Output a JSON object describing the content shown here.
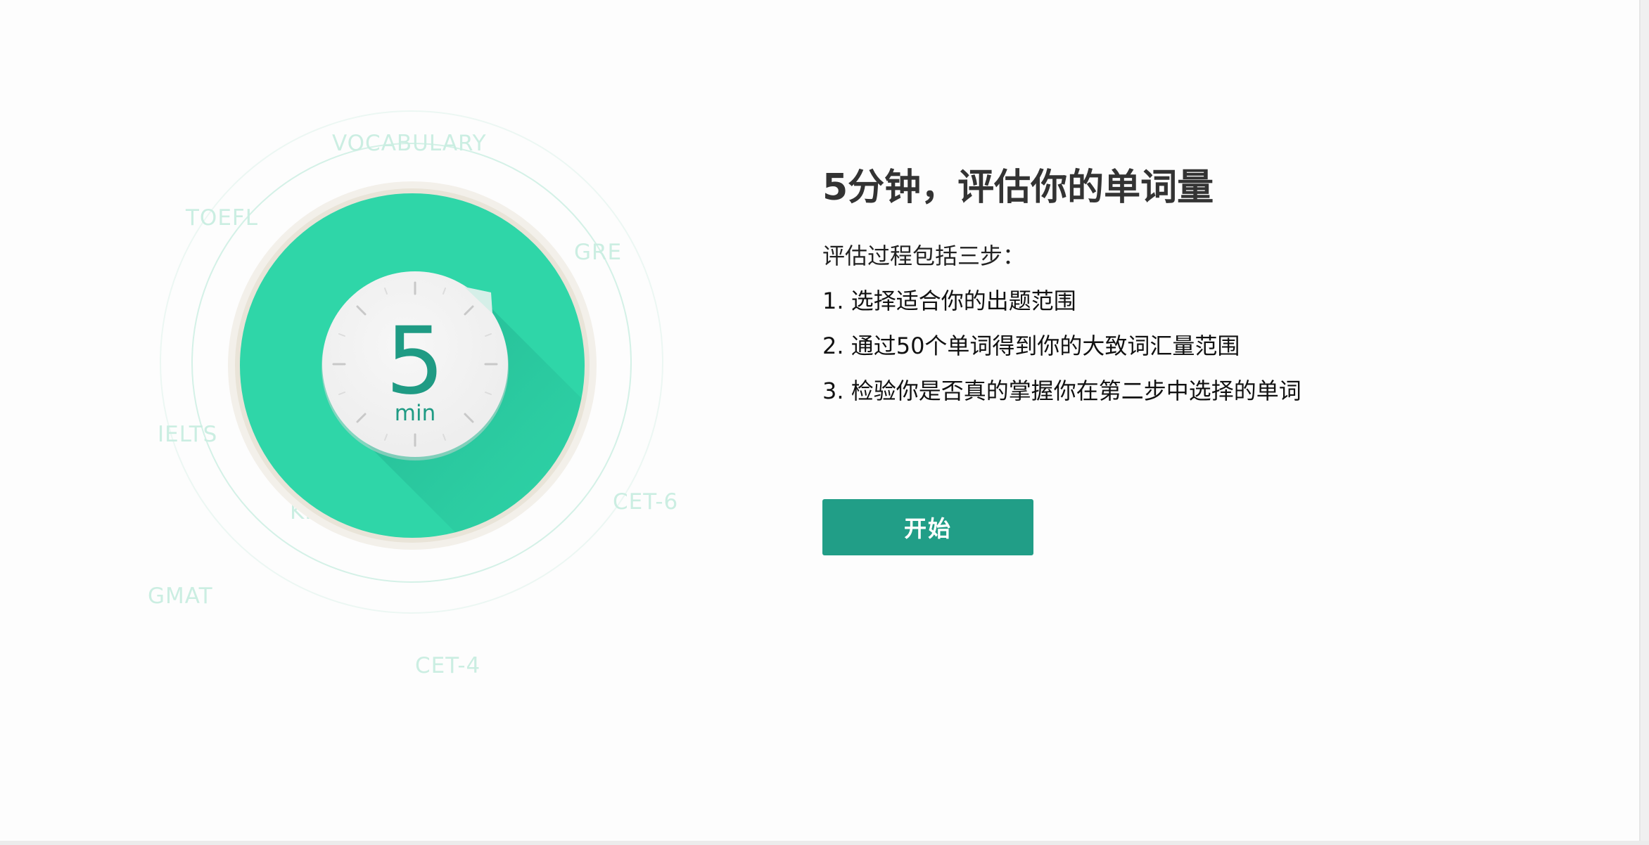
{
  "illustration": {
    "tags": {
      "vocabulary": "VOCABULARY",
      "toefl": "TOEFL",
      "gre": "GRE",
      "ielts": "IELTS",
      "kish": "KISH",
      "cet6": "CET-6",
      "gmat": "GMAT",
      "cet4": "CET-4"
    },
    "clock": {
      "number": "5",
      "unit": "min"
    },
    "colors": {
      "disc": "#2fd6a8",
      "accent": "#1f9b84",
      "tag": "#cbeee2"
    }
  },
  "content": {
    "title": "5分钟，评估你的单词量",
    "intro": "评估过程包括三步：",
    "steps": [
      "1. 选择适合你的出题范围",
      "2. 通过50个单词得到你的大致词汇量范围",
      "3. 检验你是否真的掌握你在第二步中选择的单词"
    ],
    "start_label": "开始",
    "button_color": "#219e87"
  }
}
